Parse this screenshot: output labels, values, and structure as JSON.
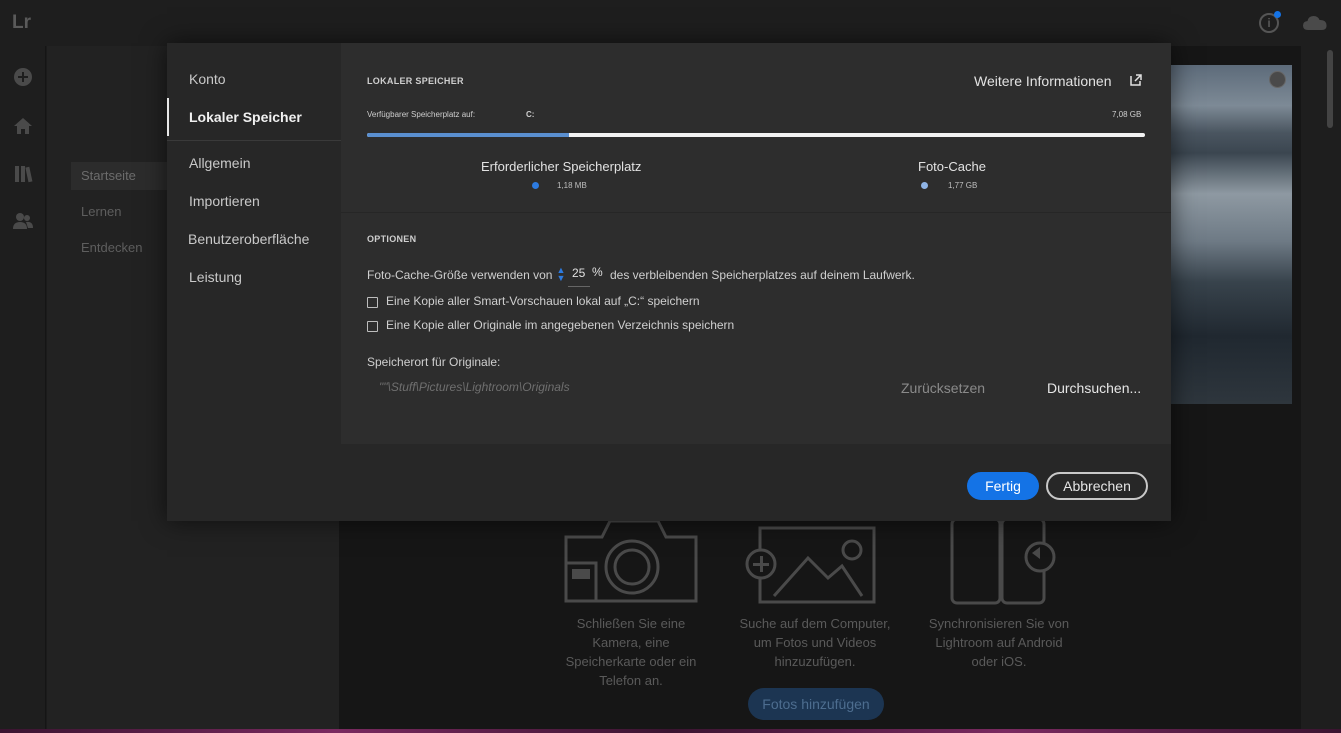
{
  "app": {
    "logo": "Lr",
    "info_icon": "i"
  },
  "background_nav": {
    "items": [
      {
        "label": "Startseite",
        "active": true
      },
      {
        "label": "Lernen",
        "active": false
      },
      {
        "label": "Entdecken",
        "active": false
      }
    ]
  },
  "empty_state": {
    "cards": [
      {
        "text_lines": [
          "Schließen Sie eine",
          "Kamera, eine",
          "Speicherkarte oder ein",
          "Telefon an."
        ]
      },
      {
        "text_lines": [
          "Suche auf dem Computer,",
          "um Fotos und Videos",
          "hinzuzufügen."
        ]
      },
      {
        "text_lines": [
          "Synchronisieren Sie von",
          "Lightroom auf Android",
          "oder iOS."
        ]
      }
    ],
    "add_button": "Fotos hinzufügen"
  },
  "dialog": {
    "nav": {
      "items": [
        "Konto",
        "Lokaler Speicher",
        "Allgemein",
        "Importieren",
        "Benutzeroberfläche",
        "Leistung"
      ],
      "active_index": 1
    },
    "storage": {
      "section_title": "LOKALER SPEICHER",
      "more_info": "Weitere Informationen",
      "available_label": "Verfügbarer Speicherplatz auf:",
      "drive": "C:",
      "available_value": "7,08 GB",
      "used_fraction": 0.26,
      "legend": [
        {
          "title": "Erforderlicher Speicherplatz",
          "value": "1,18 MB",
          "color": "#2d7be0"
        },
        {
          "title": "Foto-Cache",
          "value": "1,77 GB",
          "color": "#8fb4e6"
        }
      ]
    },
    "options": {
      "section_title": "OPTIONEN",
      "cache_prefix": "Foto-Cache-Größe verwenden von",
      "cache_value": "25",
      "cache_unit": "%",
      "cache_suffix": "des verbleibenden Speicherplatzes auf deinem Laufwerk.",
      "checkbox_smart_previews": "Eine Kopie aller Smart-Vorschauen lokal auf „C:“ speichern",
      "checkbox_originals": "Eine Kopie aller Originale im angegebenen Verzeichnis speichern",
      "location_label": "Speicherort für Originale:",
      "location_path": "\"\"\\Stuff\\Pictures\\Lightroom\\Originals",
      "reset": "Zurücksetzen",
      "browse": "Durchsuchen..."
    },
    "buttons": {
      "done": "Fertig",
      "cancel": "Abbrechen"
    }
  }
}
